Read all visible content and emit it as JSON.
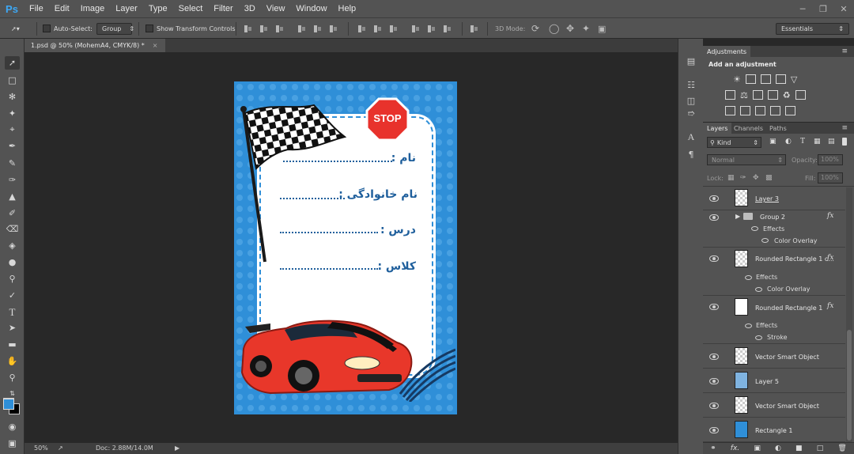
{
  "app": {
    "logo": "Ps",
    "menu": [
      "File",
      "Edit",
      "Image",
      "Layer",
      "Type",
      "Select",
      "Filter",
      "3D",
      "View",
      "Window",
      "Help"
    ]
  },
  "options": {
    "auto_select_label": "Auto-Select:",
    "auto_select_value": "Group",
    "show_transform_label": "Show Transform Controls",
    "mode_3d_label": "3D Mode:",
    "workspace": "Essentials"
  },
  "document": {
    "tab_title": "1.psd @ 50% (MohemA4, CMYK/8) *",
    "tab_close": "×",
    "zoom": "50%",
    "doc_size": "Doc: 2.88M/14.0M",
    "stop_sign": "STOP",
    "fields": [
      "نام :",
      "نام خانوادگی :",
      "درس :",
      "کلاس :"
    ]
  },
  "adjustments": {
    "tab": "Adjustments",
    "title": "Add an adjustment"
  },
  "layers": {
    "tabs": [
      "Layers",
      "Channels",
      "Paths"
    ],
    "kind": "Kind",
    "blend_mode": "Normal",
    "opacity_label": "Opacity:",
    "opacity_value": "100%",
    "lock_label": "Lock:",
    "fill_label": "Fill:",
    "fill_value": "100%",
    "rows": [
      {
        "name": "Layer 3"
      },
      {
        "name": "Group 2",
        "fx": "fx",
        "effects": "Effects",
        "effect_item": "Color Overlay"
      },
      {
        "name": "Rounded Rectangle 1 c...",
        "fx": "fx",
        "effects": "Effects",
        "effect_item": "Color Overlay"
      },
      {
        "name": "Rounded Rectangle 1",
        "fx": "fx",
        "effects": "Effects",
        "effect_item": "Stroke"
      },
      {
        "name": "Vector Smart Object"
      },
      {
        "name": "Layer 5"
      },
      {
        "name": "Vector Smart Object"
      },
      {
        "name": "Rectangle 1"
      }
    ]
  },
  "colors": {
    "foreground": "#2f8fd8",
    "background": "#000000"
  }
}
